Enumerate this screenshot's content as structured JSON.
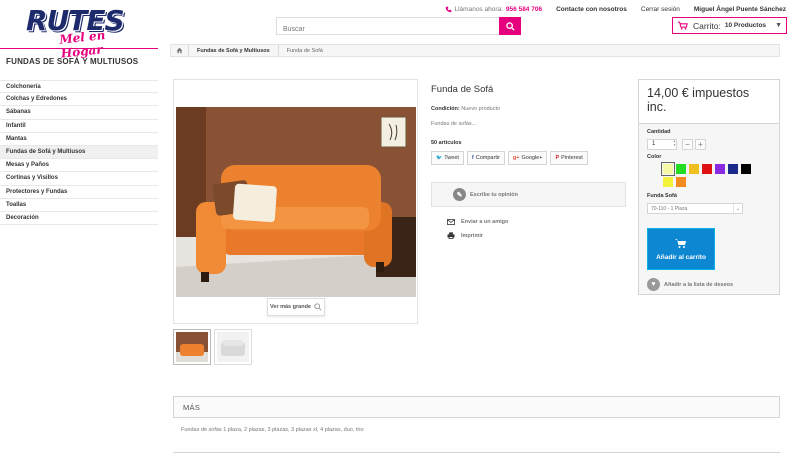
{
  "header": {
    "logo_text": "RUTES",
    "logo_tagline": "Mel en Hogar",
    "search_placeholder": "Buscar",
    "phone_label": "Llámanos ahora:",
    "phone_number": "956 584 706",
    "contact_label": "Contacte con nosotros",
    "logout_label": "Cerrar sesión",
    "user_name": "Miguel Ángel Puente Sánchez",
    "cart_label": "Carrito:",
    "cart_count": "10 Productos"
  },
  "breadcrumb": {
    "items": [
      "Fundas de Sofá y Multiusos",
      "Funda de Sofá"
    ]
  },
  "sidebar": {
    "title": "FUNDAS DE SOFÁ Y MULTIUSOS",
    "items": [
      {
        "label": "Colchonería"
      },
      {
        "label": "Colchas y Edredones"
      },
      {
        "label": "Sábanas"
      },
      {
        "label": "Infantil"
      },
      {
        "label": "Mantas"
      },
      {
        "label": "Fundas de Sofá y Multiusos"
      },
      {
        "label": "Mesas y Paños"
      },
      {
        "label": "Cortinas y Visillos"
      },
      {
        "label": "Protectores y Fundas"
      },
      {
        "label": "Toallas"
      },
      {
        "label": "Decoración"
      }
    ]
  },
  "product": {
    "zoom_label": "Ver más grande",
    "title": "Funda de Sofá",
    "condition_label": "Condición:",
    "condition_value": "Nuevo producto",
    "short_desc": "Fundas de sofás...",
    "stock": "50 artículos",
    "shares": [
      {
        "label": "Tweet",
        "icon": "twitter-icon",
        "glyph": "🐦",
        "color": "#55acee"
      },
      {
        "label": "Compartir",
        "icon": "facebook-icon",
        "glyph": "f",
        "color": "#3b5998"
      },
      {
        "label": "Google+",
        "icon": "google-plus-icon",
        "glyph": "g+",
        "color": "#dd4b39"
      },
      {
        "label": "Pinterest",
        "icon": "pinterest-icon",
        "glyph": "P",
        "color": "#cb2027"
      }
    ],
    "review_label": "Escribe tu opinión",
    "send_friend_label": "Enviar a un amigo",
    "print_label": "Imprimir"
  },
  "buybox": {
    "price": "14,00 € impuestos inc.",
    "quantity_label": "Cantidad",
    "quantity_value": "1",
    "color_label": "Color",
    "colors": [
      "#f7f7a8",
      "#22dd22",
      "#f0c020",
      "#dd1111",
      "#8a2be2",
      "#1b2a8a",
      "#000000",
      "#f2f23a",
      "#f28c1e"
    ],
    "selected_color_index": 0,
    "size_label": "Funda Sofá",
    "size_value": "70-110 - 1 Plaza",
    "add_to_cart_label": "Añadir al carrito",
    "wishlist_label": "Añadir a la lista de deseos"
  },
  "more": {
    "title": "MÁS",
    "text": "Fundas de sofás 1 plaza, 2 plazas, 3 plazas, 3 plazas xl, 4 plazas, duo, trio"
  }
}
